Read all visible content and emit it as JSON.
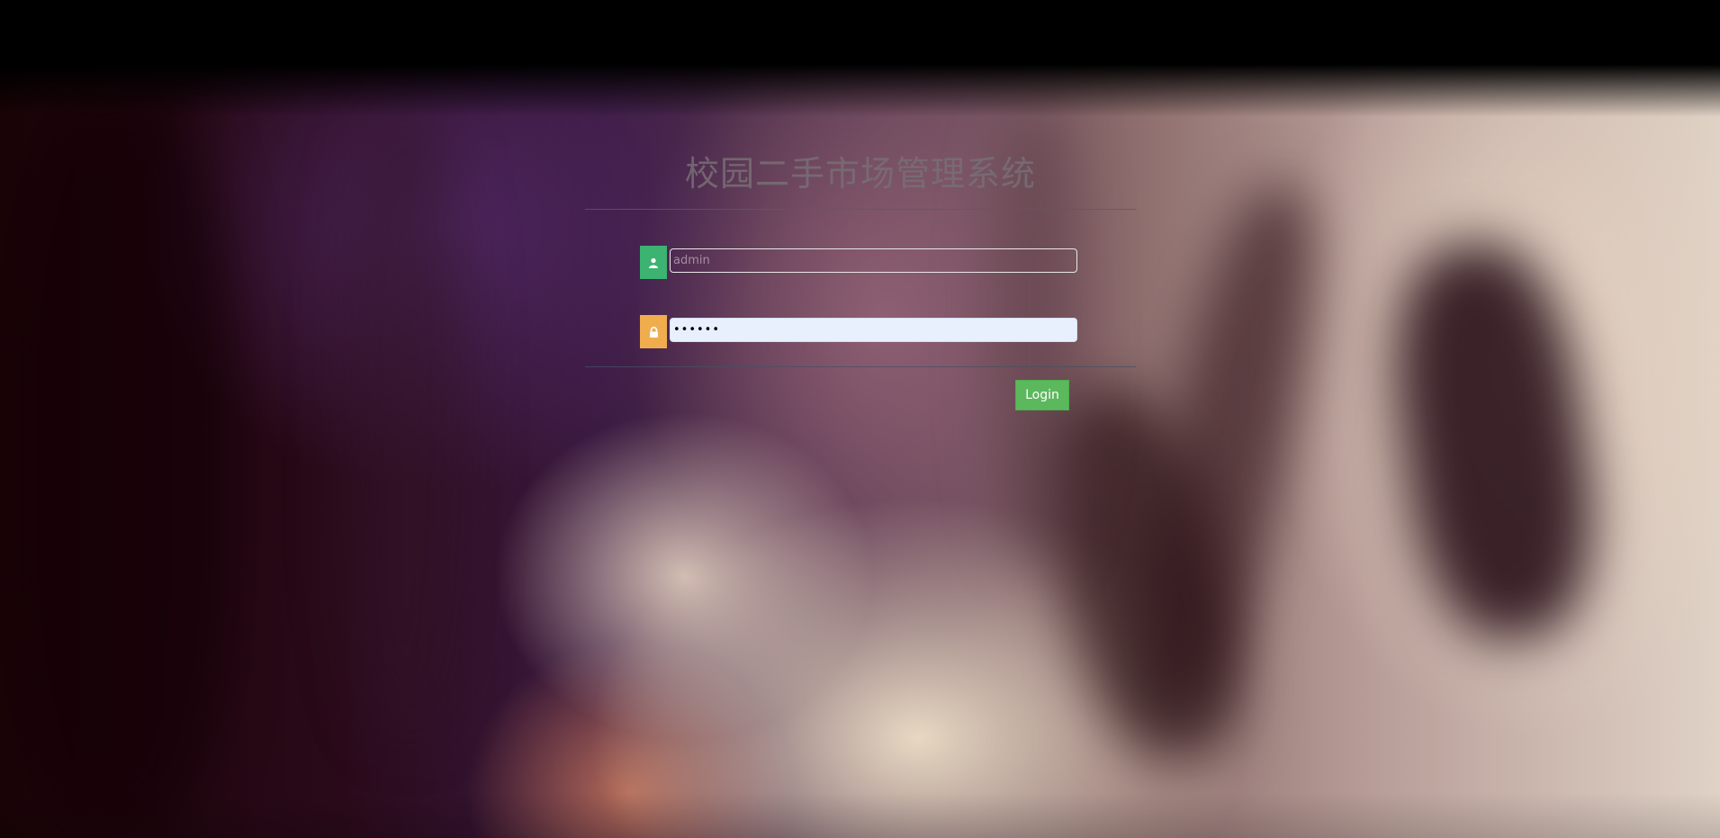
{
  "app": {
    "title": "校园二手市场管理系统"
  },
  "login": {
    "username": {
      "icon": "user-icon",
      "placeholder": "admin",
      "value": ""
    },
    "password": {
      "icon": "lock-icon",
      "value": "••••••"
    },
    "submit_label": "Login"
  },
  "colors": {
    "user_icon_bg": "#3cb371",
    "lock_icon_bg": "#f0ad4e",
    "login_button": "#5cb85c",
    "password_field_bg": "#e8f0fe"
  }
}
